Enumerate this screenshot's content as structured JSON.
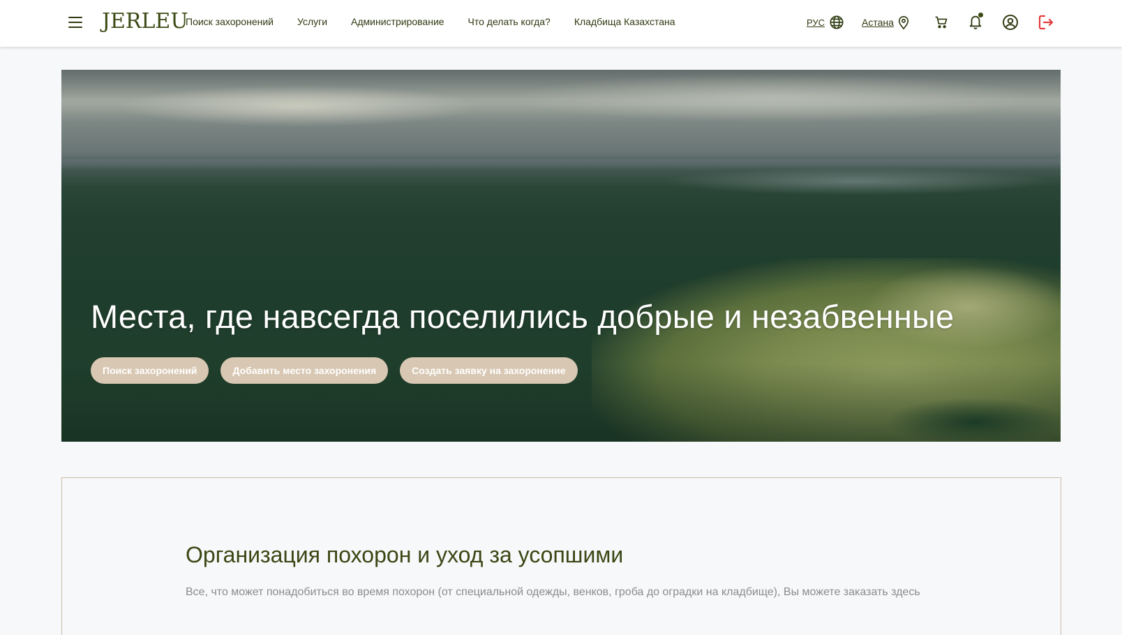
{
  "header": {
    "menu_icon": "hamburger-menu-icon",
    "logo": "JERLEU",
    "nav": [
      {
        "label": "Поиск захоронений"
      },
      {
        "label": "Услуги"
      },
      {
        "label": "Администрирование"
      },
      {
        "label": "Что делать когда?"
      },
      {
        "label": "Кладбища Казахстана"
      }
    ],
    "language": {
      "label": "РУС",
      "icon": "globe-icon"
    },
    "city": {
      "label": "Астана",
      "icon": "location-pin-icon"
    },
    "icons": {
      "cart": "shopping-cart-icon",
      "notifications": "bell-icon",
      "account": "user-circle-icon",
      "logout": "logout-icon"
    }
  },
  "hero": {
    "title": "Места, где навсегда поселились добрые и незабвенные",
    "buttons": [
      {
        "label": "Поиск захоронений"
      },
      {
        "label": "Добавить место захоронения"
      },
      {
        "label": "Создать заявку на захоронение"
      }
    ]
  },
  "info": {
    "title": "Организация похорон и уход за усопшими",
    "text": "Все, что может понадобиться во время похорон (от специальной одежды, венков, гроба до оградки на кладбище), Вы можете заказать здесь"
  },
  "colors": {
    "accent": "#3b4a14",
    "button_bg": "#d8c8b3",
    "logout": "#e23b3b",
    "card_border": "#cdbba6"
  }
}
